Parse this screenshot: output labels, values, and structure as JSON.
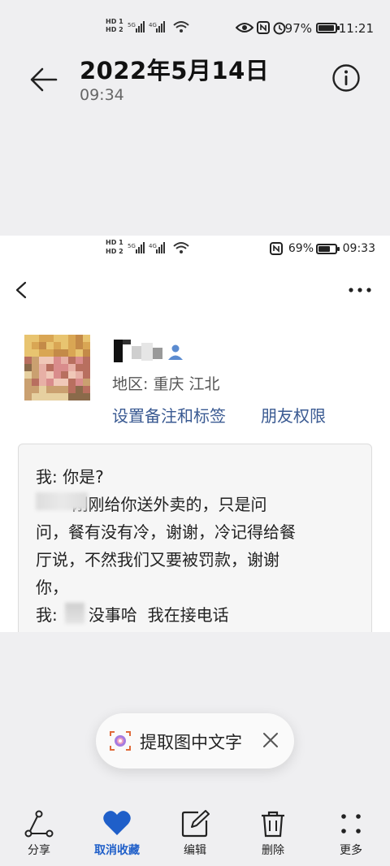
{
  "status_bar": {
    "sim1": "HD 1",
    "sim2": "HD 2",
    "net1": "5G",
    "net2": "4G",
    "battery_percent": "97%",
    "battery_level": 0.97,
    "time": "11:21"
  },
  "header": {
    "title": "2022年5月14日",
    "subtitle": "09:34"
  },
  "screenshot": {
    "status_bar": {
      "net1": "5G",
      "net2": "4G",
      "battery_percent": "69%",
      "battery_level": 0.69,
      "time": "09:33"
    },
    "profile": {
      "region": "地区:  重庆  江北",
      "set_remark_link": "设置备注和标签",
      "friend_permission_link": "朋友权限"
    },
    "message_lines": [
      "我: 你是?",
      "       刚刚给你送外卖的，只是问",
      "问，餐有没有冷，谢谢，冷记得给餐",
      "厅说，不然我们又要被罚款，谢谢",
      "你，",
      "我:      没事哈  我在接电话"
    ]
  },
  "extract_pill": {
    "label": "提取图中文字"
  },
  "toolbar": {
    "share": "分享",
    "unfavorite": "取消收藏",
    "edit": "编辑",
    "delete": "删除",
    "more": "更多"
  },
  "colors": {
    "link": "#3a5a92",
    "active": "#1f5fc9",
    "background": "#efeff1"
  }
}
